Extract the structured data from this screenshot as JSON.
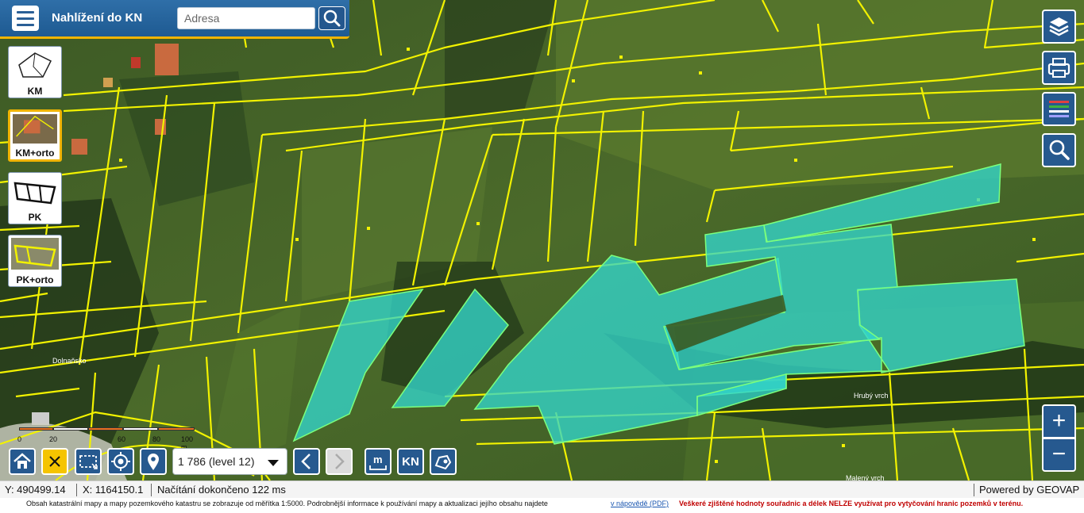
{
  "header": {
    "title": "Nahlížení do KN",
    "search_placeholder": "Adresa"
  },
  "map_types": [
    {
      "label": "KM",
      "active": false
    },
    {
      "label": "KM+orto",
      "active": true
    },
    {
      "label": "PK",
      "active": false
    },
    {
      "label": "PK+orto",
      "active": false
    }
  ],
  "map_labels": {
    "place_1": "Dolnaňsko",
    "place_2": "Hrubý vrch",
    "place_3": "Malený vrch"
  },
  "toolbar": {
    "scale_value": "1 786 (level 12)",
    "kn_label": "KN"
  },
  "scalebar": {
    "ticks": [
      "0",
      "20",
      "60",
      "80",
      "100 m"
    ]
  },
  "status": {
    "y": "Y: 490499.14",
    "x": "X: 1164150.1",
    "load": "Načítání dokončeno 122 ms",
    "powered": "Powered by GEOVAP"
  },
  "info": {
    "text": "Obsah katastrální mapy a mapy pozemkového katastru se zobrazuje od měřítka 1:5000. Podrobnější informace k používání mapy a aktualizaci jejího obsahu najdete",
    "link": "v nápovědě (PDF)",
    "warning": "Veškeré zjištěné hodnoty souřadnic a délek NELZE využívat pro vytyčování hranic pozemků v terénu."
  },
  "colors": {
    "parcel_line": "#f2f200",
    "highlight": "#33d6cc",
    "accent": "#f0b400",
    "button": "#26598f"
  },
  "icons": {
    "menu": "hamburger-icon",
    "search": "magnifier-icon",
    "layers": "layers-icon",
    "print": "printer-icon",
    "legend": "legend-icon",
    "find": "magnifier-icon",
    "home": "home-icon",
    "clear": "close-icon",
    "select": "rectangle-select-icon",
    "locate": "crosshair-icon",
    "marker": "map-pin-icon",
    "prev": "chevron-left-icon",
    "next": "chevron-right-icon",
    "measure": "ruler-icon",
    "draw": "draw-polygon-icon"
  }
}
